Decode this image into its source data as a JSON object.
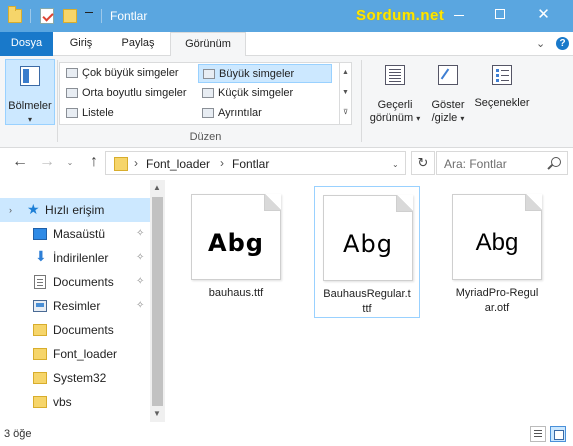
{
  "window": {
    "title": "Fontlar",
    "watermark": "Sordum.net",
    "minimize": "–",
    "maximize": "□",
    "close": "✕"
  },
  "ribbon": {
    "tabs": [
      {
        "label": "Dosya"
      },
      {
        "label": "Giriş"
      },
      {
        "label": "Paylaş"
      },
      {
        "label": "Görünüm"
      }
    ],
    "help": "?",
    "expand": "⌄",
    "panes_button": {
      "line1": "Bölmeler",
      "caret": "▾"
    },
    "layout_items": [
      {
        "label": "Çok büyük simgeler",
        "selected": false
      },
      {
        "label": "Büyük simgeler",
        "selected": true
      },
      {
        "label": "Orta boyutlu simgeler",
        "selected": false
      },
      {
        "label": "Küçük simgeler",
        "selected": false
      },
      {
        "label": "Listele",
        "selected": false
      },
      {
        "label": "Ayrıntılar",
        "selected": false
      }
    ],
    "layout_group_label": "Düzen",
    "current_view_button": {
      "line1": "Geçerli",
      "line2": "görünüm",
      "caret": "▾"
    },
    "show_hide_button": {
      "line1": "Göster",
      "line2": "/gizle",
      "caret": "▾"
    },
    "options_button": {
      "line1": "Seçenekler"
    }
  },
  "address_bar": {
    "breadcrumbs": [
      "Font_loader",
      "Fontlar"
    ],
    "separator": "›",
    "dropdown": "⌄",
    "refresh": "↻",
    "search_placeholder": "Ara: Fontlar"
  },
  "navigation": {
    "back": "←",
    "forward": "→",
    "recent": "⌄",
    "up": "↑"
  },
  "nav_pane": {
    "quick_access_label": "Hızlı erişim",
    "expand": "›",
    "items": [
      {
        "label": "Masaüstü",
        "icon": "desktop-icon",
        "pinned": true
      },
      {
        "label": "İndirilenler",
        "icon": "downloads-icon",
        "pinned": true
      },
      {
        "label": "Documents",
        "icon": "documents-icon",
        "pinned": true
      },
      {
        "label": "Resimler",
        "icon": "pictures-icon",
        "pinned": true
      },
      {
        "label": "Documents",
        "icon": "folder-icon",
        "pinned": false
      },
      {
        "label": "Font_loader",
        "icon": "folder-icon",
        "pinned": false
      },
      {
        "label": "System32",
        "icon": "folder-icon",
        "pinned": false
      },
      {
        "label": "vbs",
        "icon": "folder-icon",
        "pinned": false
      }
    ],
    "pin_glyph": "📌",
    "scroll_up": "▲",
    "scroll_down": "▼"
  },
  "files": [
    {
      "name": "bauhaus.ttf",
      "preview": "Abg",
      "selected": false
    },
    {
      "name": "BauhausRegular.ttf",
      "preview": "Abg",
      "selected": true
    },
    {
      "name": "MyriadPro-Regular.otf",
      "preview": "Abg",
      "selected": false
    }
  ],
  "file_name_display": [
    "bauhaus.ttf",
    "BauhausRegular.t\nttf",
    "MyriadPro-Regul\nar.otf"
  ],
  "status": {
    "item_count": "3 öğe"
  }
}
